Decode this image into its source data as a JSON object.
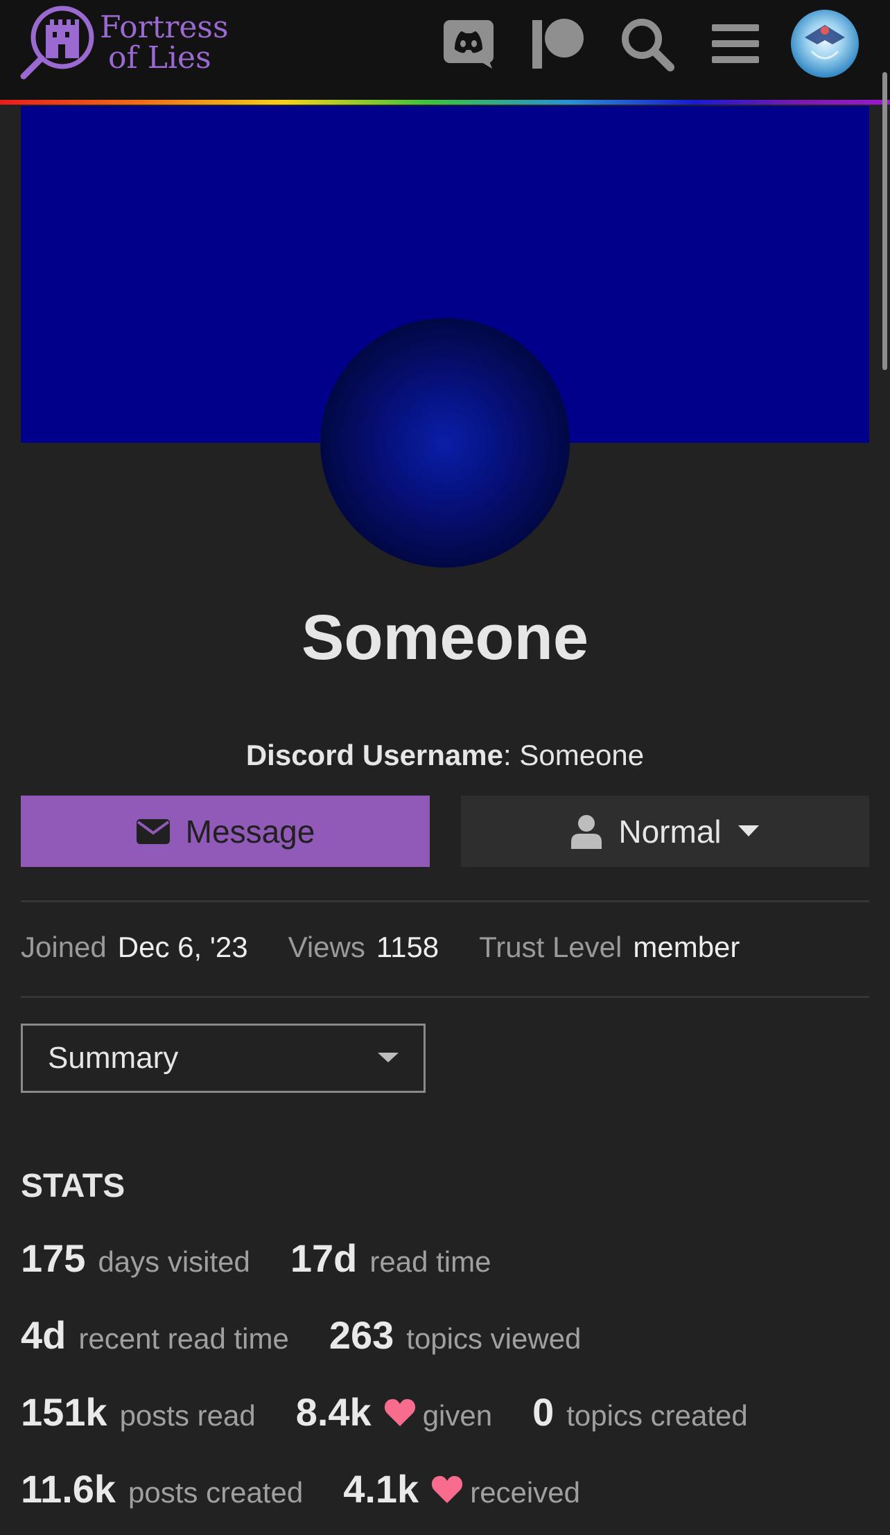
{
  "header": {
    "logo_line1": "Fortress",
    "logo_line2": "of Lies",
    "icons": [
      "discord-icon",
      "patreon-icon",
      "search-icon",
      "hamburger-menu-icon",
      "user-avatar"
    ]
  },
  "profile": {
    "username": "Someone",
    "discord_label": "Discord Username",
    "discord_sep": ": ",
    "discord_value": "Someone"
  },
  "buttons": {
    "message": "Message",
    "notification_level": "Normal"
  },
  "meta": {
    "joined_label": "Joined",
    "joined_value": "Dec 6, '23",
    "views_label": "Views",
    "views_value": "1158",
    "trust_label": "Trust Level",
    "trust_value": "member"
  },
  "nav_select": {
    "selected": "Summary"
  },
  "stats": {
    "title": "STATS",
    "rows": [
      [
        {
          "num": "175",
          "label": "days visited"
        },
        {
          "num": "17d",
          "label": "read time"
        }
      ],
      [
        {
          "num": "4d",
          "label": "recent read time"
        },
        {
          "num": "263",
          "label": "topics viewed"
        }
      ],
      [
        {
          "num": "151k",
          "label": "posts read"
        },
        {
          "num": "8.4k",
          "label": "given"
        },
        {
          "num": "0",
          "label": "topics created"
        }
      ],
      [
        {
          "num": "11.6k",
          "label": "posts created"
        },
        {
          "num": "4.1k",
          "label": "received"
        }
      ]
    ]
  },
  "colors": {
    "accent": "#9159b8",
    "banner": "#00008a",
    "heart": "#fa6c8d",
    "background": "#222222"
  }
}
